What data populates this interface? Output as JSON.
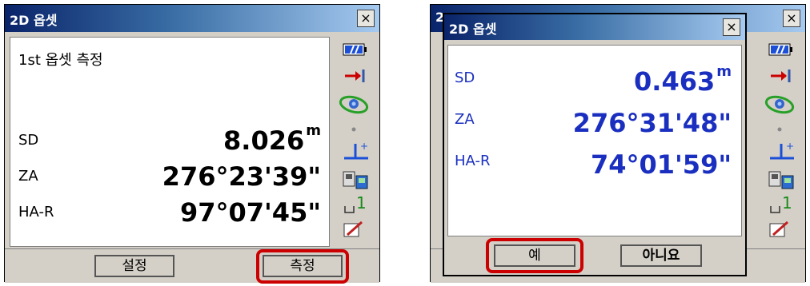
{
  "left": {
    "title": "2D 옵셋",
    "close": "×",
    "heading": "1st 옵셋 측정",
    "rows": [
      {
        "label": "SD",
        "value": "8.026",
        "unit": "m"
      },
      {
        "label": "ZA",
        "value": "276°23'39\"",
        "unit": ""
      },
      {
        "label": "HA-R",
        "value": "97°07'45\"",
        "unit": ""
      }
    ],
    "buttons": {
      "settings": "설정",
      "measure": "측정"
    },
    "status_icons": [
      "battery-icon",
      "target-arrow-icon",
      "prism-icon",
      "dot-icon",
      "tilt-icon",
      "instrument-icon",
      "level-icon",
      "edit-icon"
    ],
    "status_text": {
      "level": "1"
    }
  },
  "right": {
    "title_under": "2",
    "close": "×",
    "dialog": {
      "title": "2D 옵셋",
      "close": "×",
      "rows": [
        {
          "label": "SD",
          "value": "0.463",
          "unit": "m"
        },
        {
          "label": "ZA",
          "value": "276°31'48\"",
          "unit": ""
        },
        {
          "label": "HA-R",
          "value": "74°01'59\"",
          "unit": ""
        }
      ],
      "buttons": {
        "yes": "예",
        "no": "아니요"
      }
    },
    "status_text": {
      "level": "1"
    }
  },
  "colors": {
    "highlight": "#cc0000",
    "value_blue": "#1a2fbf",
    "title_start": "#0a246a"
  }
}
